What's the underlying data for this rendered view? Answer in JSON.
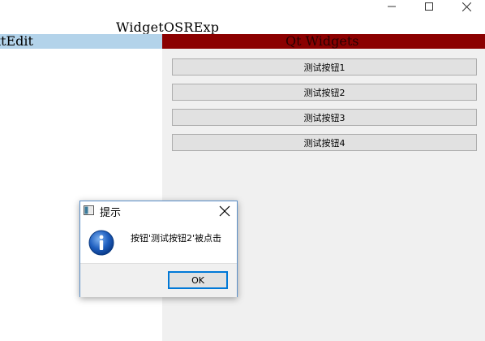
{
  "window": {
    "title": "WidgetOSRExp",
    "controls": {
      "minimize_icon": "minimize-icon",
      "maximize_icon": "maximize-icon",
      "close_icon": "close-icon"
    }
  },
  "left_panel": {
    "header_label": "xtEdit",
    "header_color": "#b3d3ea"
  },
  "right_panel": {
    "header_label": "Qt Widgets",
    "header_color": "#8b0000",
    "buttons": [
      {
        "label": "测试按钮1"
      },
      {
        "label": "测试按钮2"
      },
      {
        "label": "测试按钮3"
      },
      {
        "label": "测试按钮4"
      }
    ]
  },
  "dialog": {
    "title": "提示",
    "icon": "info-icon",
    "message": "按钮'测试按钮2'被点击",
    "ok_label": "OK",
    "accent_color": "#0078d7"
  }
}
